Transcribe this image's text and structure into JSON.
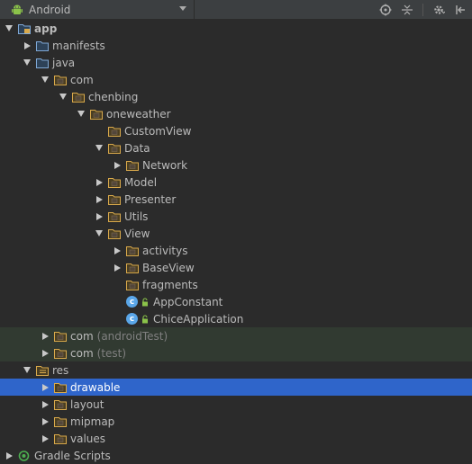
{
  "toolbar": {
    "view_label": "Android",
    "icons": [
      "target-icon",
      "collapse-all-icon",
      "gear-icon",
      "hide-icon"
    ]
  },
  "colors": {
    "panel_bg": "#2b2b2b",
    "toolbar_bg": "#3c3f41",
    "folder_blue": "#7fa8d6",
    "folder_yellow": "#d9a94b",
    "selection": "#2f65ca",
    "test_bg": "#313a31",
    "class_icon": "#5aa6e8"
  },
  "tree": [
    {
      "name": "app",
      "depth": 0,
      "expanded": true,
      "icon": "module",
      "bold": true
    },
    {
      "name": "manifests",
      "depth": 1,
      "expanded": false,
      "icon": "folder-blue"
    },
    {
      "name": "java",
      "depth": 1,
      "expanded": true,
      "icon": "folder-blue"
    },
    {
      "name": "com",
      "depth": 2,
      "expanded": true,
      "icon": "package"
    },
    {
      "name": "chenbing",
      "depth": 3,
      "expanded": true,
      "icon": "package"
    },
    {
      "name": "oneweather",
      "depth": 4,
      "expanded": true,
      "icon": "package"
    },
    {
      "name": "CustomView",
      "depth": 5,
      "expanded": null,
      "icon": "package"
    },
    {
      "name": "Data",
      "depth": 5,
      "expanded": true,
      "icon": "package"
    },
    {
      "name": "Network",
      "depth": 6,
      "expanded": false,
      "icon": "package"
    },
    {
      "name": "Model",
      "depth": 5,
      "expanded": false,
      "icon": "package"
    },
    {
      "name": "Presenter",
      "depth": 5,
      "expanded": false,
      "icon": "package"
    },
    {
      "name": "Utils",
      "depth": 5,
      "expanded": false,
      "icon": "package"
    },
    {
      "name": "View",
      "depth": 5,
      "expanded": true,
      "icon": "package"
    },
    {
      "name": "activitys",
      "depth": 6,
      "expanded": false,
      "icon": "package"
    },
    {
      "name": "BaseView",
      "depth": 6,
      "expanded": false,
      "icon": "package"
    },
    {
      "name": "fragments",
      "depth": 6,
      "expanded": null,
      "icon": "package"
    },
    {
      "name": "AppConstant",
      "depth": 6,
      "expanded": null,
      "icon": "class"
    },
    {
      "name": "ChiceApplication",
      "depth": 6,
      "expanded": null,
      "icon": "class"
    },
    {
      "name": "com",
      "suffix": "(androidTest)",
      "depth": 2,
      "expanded": false,
      "icon": "package",
      "test": true
    },
    {
      "name": "com",
      "suffix": "(test)",
      "depth": 2,
      "expanded": false,
      "icon": "package",
      "test": true
    },
    {
      "name": "res",
      "depth": 1,
      "expanded": true,
      "icon": "res"
    },
    {
      "name": "drawable",
      "depth": 2,
      "expanded": false,
      "icon": "package",
      "selected": true
    },
    {
      "name": "layout",
      "depth": 2,
      "expanded": false,
      "icon": "package"
    },
    {
      "name": "mipmap",
      "depth": 2,
      "expanded": false,
      "icon": "package"
    },
    {
      "name": "values",
      "depth": 2,
      "expanded": false,
      "icon": "package"
    },
    {
      "name": "Gradle Scripts",
      "depth": 0,
      "expanded": false,
      "icon": "gradle"
    }
  ]
}
